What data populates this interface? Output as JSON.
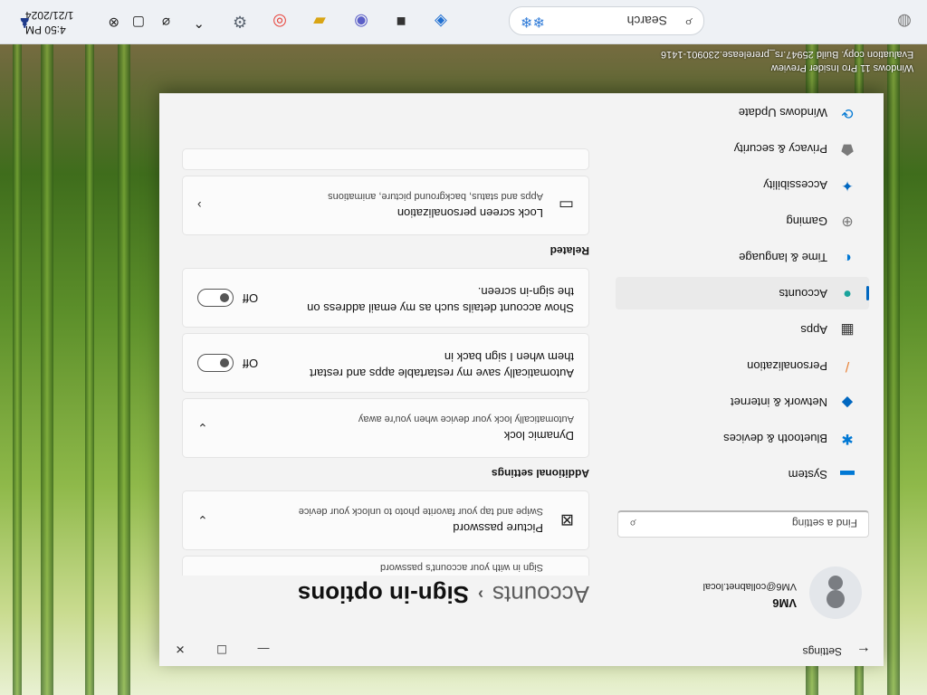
{
  "taskbar": {
    "search_placeholder": "Search",
    "clock_time": "4:50 PM",
    "clock_date": "1/21/2024"
  },
  "watermark": {
    "line1": "Windows 11 Pro Insider Preview",
    "line2": "Evaluation copy. Build 25947.rs_prerelease.230901-1416"
  },
  "window": {
    "title": "Settings",
    "controls": {
      "minimize": "—",
      "maximize": "☐",
      "close": "✕"
    }
  },
  "user": {
    "name": "VM6",
    "email": "VM6@collabnet.local"
  },
  "find_setting": {
    "placeholder": "Find a setting"
  },
  "nav": [
    {
      "label": "System",
      "icon": "monitor-icon",
      "color": "#0078d4"
    },
    {
      "label": "Bluetooth & devices",
      "icon": "bluetooth-icon",
      "color": "#0078d4"
    },
    {
      "label": "Network & internet",
      "icon": "wifi-icon",
      "color": "#0067c0"
    },
    {
      "label": "Personalization",
      "icon": "brush-icon",
      "color": "#e8833a"
    },
    {
      "label": "Apps",
      "icon": "apps-icon",
      "color": "#3a3a3a"
    },
    {
      "label": "Accounts",
      "icon": "person-icon",
      "color": "#1ba39c",
      "active": true
    },
    {
      "label": "Time & language",
      "icon": "globe-clock-icon",
      "color": "#0078d4"
    },
    {
      "label": "Gaming",
      "icon": "gamepad-icon",
      "color": "#777777"
    },
    {
      "label": "Accessibility",
      "icon": "accessibility-icon",
      "color": "#0067c0"
    },
    {
      "label": "Privacy & security",
      "icon": "shield-icon",
      "color": "#7a7a7a"
    },
    {
      "label": "Windows Update",
      "icon": "update-icon",
      "color": "#0078d4"
    }
  ],
  "breadcrumb": {
    "parent": "Accounts",
    "separator": "›",
    "current": "Sign-in options"
  },
  "cards": {
    "password_sub": "Sign in with your account's password",
    "picture_password": {
      "title": "Picture password",
      "sub": "Swipe and tap your favorite photo to unlock your device"
    },
    "additional_settings_header": "Additional settings",
    "dynamic_lock": {
      "title": "Dynamic lock",
      "sub": "Automatically lock your device when you're away"
    },
    "auto_save": {
      "title": "Automatically save my restartable apps and restart them when I sign back in",
      "state": "Off"
    },
    "show_details": {
      "title": "Show account details such as my email address on the sign-in screen.",
      "state": "Off"
    },
    "related_header": "Related",
    "lock_screen": {
      "title": "Lock screen personalization",
      "sub": "Apps and status, background picture, animations"
    }
  }
}
